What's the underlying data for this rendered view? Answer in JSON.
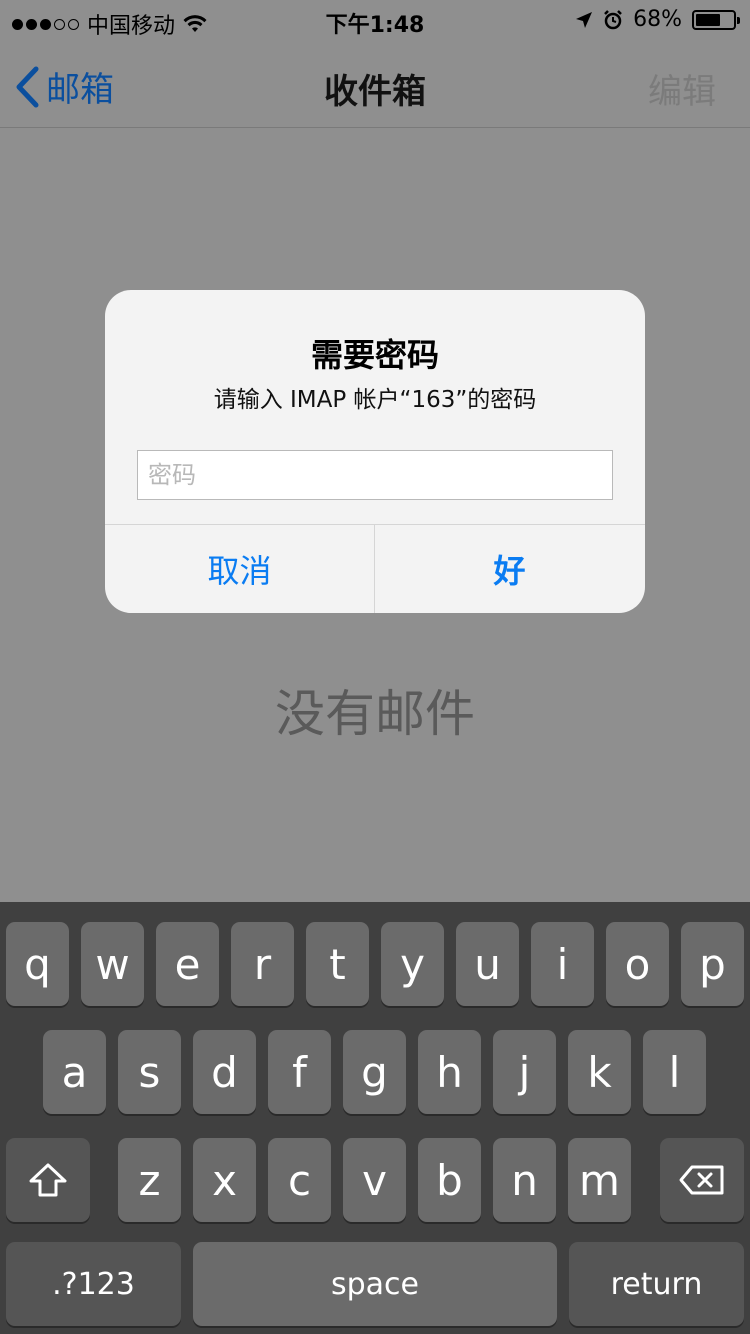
{
  "status_bar": {
    "carrier": "中国移动",
    "time": "下午1:48",
    "battery_percent": "68%",
    "battery_level": 0.68,
    "signal_bars": 3,
    "signal_total": 5,
    "icons": [
      "wifi-icon",
      "location-arrow-icon",
      "alarm-icon",
      "battery-icon"
    ]
  },
  "nav": {
    "back_label": "邮箱",
    "title": "收件箱",
    "edit_label": "编辑"
  },
  "empty_state": {
    "label": "没有邮件"
  },
  "alert": {
    "title": "需要密码",
    "message": "请输入 IMAP 帐户“163”的密码",
    "input_placeholder": "密码",
    "input_value": "",
    "cancel_label": "取消",
    "ok_label": "好"
  },
  "keyboard": {
    "row1": [
      "q",
      "w",
      "e",
      "r",
      "t",
      "y",
      "u",
      "i",
      "o",
      "p"
    ],
    "row2": [
      "a",
      "s",
      "d",
      "f",
      "g",
      "h",
      "j",
      "k",
      "l"
    ],
    "row3": [
      "z",
      "x",
      "c",
      "v",
      "b",
      "n",
      "m"
    ],
    "numbers_label": ".?123",
    "space_label": "space",
    "return_label": "return",
    "shift_icon": "shift-icon",
    "delete_icon": "delete-icon"
  },
  "colors": {
    "accent": "#0a7cf2",
    "nav_back": "#0b4f9e",
    "dim_background": "#8f8f8f",
    "keyboard_background": "#404040"
  }
}
